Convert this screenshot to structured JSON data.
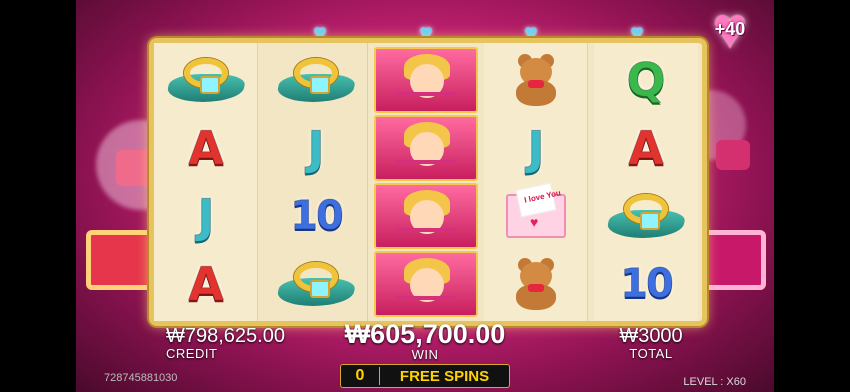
{
  "bonus": {
    "value": "+40"
  },
  "reels": [
    [
      "ring",
      "A",
      "J",
      "A"
    ],
    [
      "ring",
      "J",
      "10",
      "ring"
    ],
    [
      "cupid",
      "cupid",
      "cupid",
      "cupid"
    ],
    [
      "bear",
      "J",
      "envelope",
      "bear"
    ],
    [
      "Q",
      "A",
      "ring",
      "10"
    ]
  ],
  "envelope_text": "I love You",
  "stats": {
    "credit": {
      "value": "₩798,625.00",
      "label": "CREDIT"
    },
    "win": {
      "value": "₩605,700.00",
      "label": "WIN"
    },
    "total": {
      "value": "₩3000",
      "label": "TOTAL"
    }
  },
  "free_spins": {
    "count": "0",
    "label": "FREE SPINS"
  },
  "game_id": "728745881030",
  "level": "LEVEL : X60",
  "colors": {
    "frame": "#e7c35e",
    "background": "#d8267c",
    "accent": "#ffd200"
  },
  "icons": {
    "reel_heart": "heart-icon",
    "bonus": "heart-icon"
  }
}
